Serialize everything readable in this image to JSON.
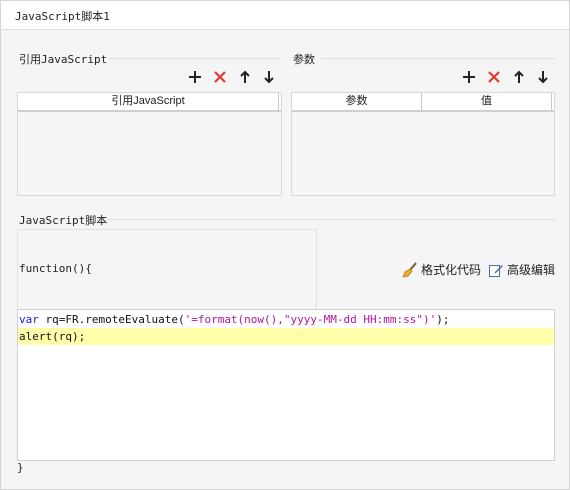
{
  "window": {
    "title": "JavaScript脚本1"
  },
  "references": {
    "section_label": "引用JavaScript",
    "column_header": "引用JavaScript"
  },
  "parameters": {
    "section_label": "参数",
    "columns": [
      "参数",
      "值"
    ]
  },
  "toolbar_icons": [
    "plus-icon",
    "delete-icon",
    "arrow-up-icon",
    "arrow-down-icon"
  ],
  "script": {
    "section_label": "JavaScript脚本",
    "function_open": "function(){",
    "function_close": "}",
    "format_label": "格式化代码",
    "advanced_label": "高级编辑",
    "code_lines": [
      {
        "tokens": [
          {
            "t": "var",
            "c": "kw"
          },
          {
            "t": " rq=FR.remoteEvaluate(",
            "c": "plain"
          },
          {
            "t": "'=format(now(),\"yyyy-MM-dd HH:mm:ss\")'",
            "c": "str"
          },
          {
            "t": ");",
            "c": "plain"
          }
        ],
        "highlighted": false
      },
      {
        "tokens": [
          {
            "t": "alert(rq);",
            "c": "plain"
          }
        ],
        "highlighted": true
      }
    ]
  },
  "colors": {
    "delete": "#e53935",
    "highlight_line": "#ffffaa",
    "keyword": "#1a1ad4",
    "string": "#b0169d"
  }
}
